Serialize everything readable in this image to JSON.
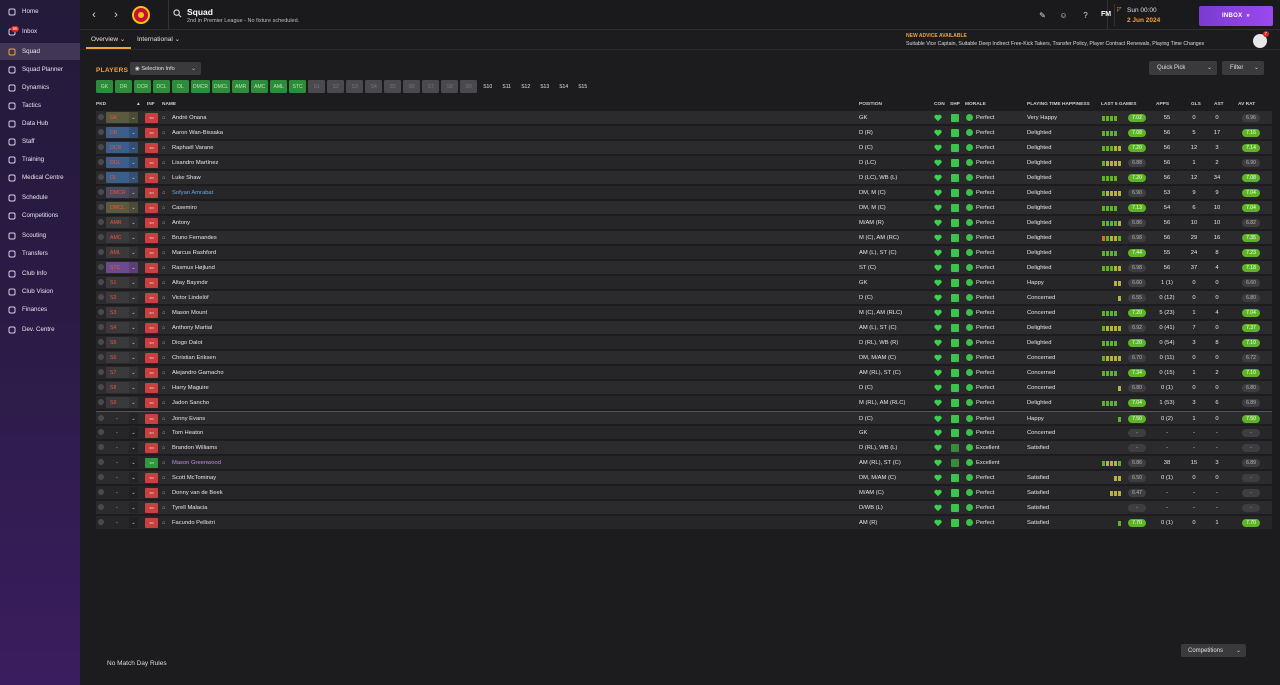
{
  "sidebar": {
    "items": [
      {
        "label": "Home",
        "icon": "home-icon"
      },
      {
        "label": "Inbox",
        "icon": "inbox-icon",
        "badge": "86"
      },
      {
        "label": "Squad",
        "icon": "squad-icon",
        "active": true
      },
      {
        "label": "Squad Planner",
        "icon": "planner-icon"
      },
      {
        "label": "Dynamics",
        "icon": "dynamics-icon"
      },
      {
        "label": "Tactics",
        "icon": "tactics-icon"
      },
      {
        "label": "Data Hub",
        "icon": "data-hub-icon"
      },
      {
        "label": "Staff",
        "icon": "staff-icon"
      },
      {
        "label": "Training",
        "icon": "training-icon"
      },
      {
        "label": "Medical Centre",
        "icon": "medical-icon"
      },
      {
        "label": "Schedule",
        "icon": "schedule-icon"
      },
      {
        "label": "Competitions",
        "icon": "trophy-icon"
      },
      {
        "label": "Scouting",
        "icon": "scouting-icon"
      },
      {
        "label": "Transfers",
        "icon": "transfers-icon"
      },
      {
        "label": "Club Info",
        "icon": "club-info-icon"
      },
      {
        "label": "Club Vision",
        "icon": "club-vision-icon"
      },
      {
        "label": "Finances",
        "icon": "finances-icon"
      },
      {
        "label": "Dev. Centre",
        "icon": "dev-centre-icon"
      }
    ]
  },
  "header": {
    "title": "Squad",
    "subtitle": "2nd in Premier League - No fixture scheduled.",
    "fm_logo": "FM",
    "date_day": "Sun 00:00",
    "date_full": "2 Jun 2024",
    "inbox_label": "INBOX",
    "inbox_arrows": "»"
  },
  "subheader": {
    "tabs": [
      "Overview",
      "International"
    ],
    "advice_title": "NEW ADVICE AVAILABLE",
    "advice_text": "Suitable Vice Captain, Suitable Deep Indirect Free-Kick Takers, Transfer Policy, Player Contract Renewals, Playing Time Changes",
    "notification_count": "7"
  },
  "toolbar": {
    "players_label": "PLAYERS",
    "selection_info": "Selection Info",
    "quick_pick": "Quick Pick",
    "filter": "Filter"
  },
  "position_buttons": [
    {
      "label": "GK",
      "style": "green"
    },
    {
      "label": "DR",
      "style": "green"
    },
    {
      "label": "DCR",
      "style": "green"
    },
    {
      "label": "DCL",
      "style": "green"
    },
    {
      "label": "DL",
      "style": "green"
    },
    {
      "label": "DMCR",
      "style": "green"
    },
    {
      "label": "DMCL",
      "style": "green"
    },
    {
      "label": "AMR",
      "style": "green"
    },
    {
      "label": "AMC",
      "style": "green"
    },
    {
      "label": "AML",
      "style": "green"
    },
    {
      "label": "STC",
      "style": "green"
    },
    {
      "label": "S1",
      "style": "grey"
    },
    {
      "label": "S2",
      "style": "grey"
    },
    {
      "label": "S3",
      "style": "grey"
    },
    {
      "label": "S4",
      "style": "grey"
    },
    {
      "label": "S5",
      "style": "grey"
    },
    {
      "label": "S6",
      "style": "grey"
    },
    {
      "label": "S7",
      "style": "grey"
    },
    {
      "label": "S8",
      "style": "grey"
    },
    {
      "label": "S9",
      "style": "grey"
    },
    {
      "label": "S10",
      "style": "plain"
    },
    {
      "label": "S11",
      "style": "plain"
    },
    {
      "label": "S12",
      "style": "plain"
    },
    {
      "label": "S13",
      "style": "plain"
    },
    {
      "label": "S14",
      "style": "plain"
    },
    {
      "label": "S15",
      "style": "plain"
    }
  ],
  "table": {
    "headers": {
      "pkd": "PKD",
      "inf": "INF",
      "name": "NAME",
      "position": "POSITION",
      "con": "CON",
      "shp": "SHP",
      "morale": "MORALE",
      "pth": "PLAYING TIME HAPPINESS",
      "last5": "LAST 5 GAMES",
      "apps": "APPS",
      "gls": "GLS",
      "ast": "AST",
      "avrat": "AV RAT"
    },
    "rows": [
      {
        "sel": "GK",
        "selc": "#5a5a40",
        "name": "André Onana",
        "pos": "GK",
        "morale": "Perfect",
        "pth": "Very Happy",
        "form": "ggggn",
        "r5": "7.02",
        "apps": "55",
        "gls": "0",
        "ast": "0",
        "avr": "6.96",
        "avrg": false
      },
      {
        "sel": "DR",
        "selc": "#3b5f8a",
        "name": "Aaron Wan-Bissaka",
        "pos": "D (R)",
        "morale": "Perfect",
        "pth": "Delighted",
        "form": "ggggn",
        "r5": "7.08",
        "apps": "56",
        "gls": "5",
        "ast": "17",
        "avr": "7.16",
        "avrg": true
      },
      {
        "sel": "DCR",
        "selc": "#3b5f8a",
        "name": "Raphaël Varane",
        "pos": "D (C)",
        "morale": "Perfect",
        "pth": "Delighted",
        "form": "gggoo",
        "r5": "7.20",
        "apps": "56",
        "gls": "12",
        "ast": "3",
        "avr": "7.14",
        "avrg": true
      },
      {
        "sel": "DCL",
        "selc": "#3b5f8a",
        "name": "Lisandro Martínez",
        "pos": "D (LC)",
        "morale": "Perfect",
        "pth": "Delighted",
        "form": "goooo",
        "r5": "6.88",
        "apps": "56",
        "gls": "1",
        "ast": "2",
        "avr": "6.90",
        "avrg": false
      },
      {
        "sel": "DL",
        "selc": "#3b5f8a",
        "name": "Luke Shaw",
        "pos": "D (LC), WB (L)",
        "morale": "Perfect",
        "pth": "Delighted",
        "form": "ggggn",
        "r5": "7.20",
        "apps": "56",
        "gls": "12",
        "ast": "34",
        "avr": "7.08",
        "avrg": true
      },
      {
        "sel": "DMCR",
        "selc": "#4a4a5e",
        "name": "Sofyan Amrabat",
        "pos": "DM, M (C)",
        "morale": "Perfect",
        "pth": "Delighted",
        "form": "goooo",
        "r5": "6.90",
        "apps": "53",
        "gls": "9",
        "ast": "9",
        "avr": "7.04",
        "avrg": true,
        "blue": true
      },
      {
        "sel": "DMCL",
        "selc": "#5a5a40",
        "name": "Casemiro",
        "pos": "DM, M (C)",
        "morale": "Perfect",
        "pth": "Delighted",
        "form": "ggggn",
        "r5": "7.13",
        "apps": "54",
        "gls": "6",
        "ast": "10",
        "avr": "7.04",
        "avrg": true
      },
      {
        "sel": "AMR",
        "selc": "#3a3a3d",
        "name": "Antony",
        "pos": "M/AM (R)",
        "morale": "Perfect",
        "pth": "Delighted",
        "form": "ggggo",
        "r5": "6.86",
        "apps": "56",
        "gls": "10",
        "ast": "10",
        "avr": "6.82",
        "avrg": false
      },
      {
        "sel": "AMC",
        "selc": "#3a3a3d",
        "name": "Bruno Fernandes",
        "pos": "M (C), AM (RC)",
        "morale": "Perfect",
        "pth": "Delighted",
        "form": "rgoog",
        "r5": "6.98",
        "apps": "56",
        "gls": "29",
        "ast": "16",
        "avr": "7.35",
        "avrg": true
      },
      {
        "sel": "AML",
        "selc": "#3a3a3d",
        "name": "Marcus Rashford",
        "pos": "AM (L), ST (C)",
        "morale": "Perfect",
        "pth": "Delighted",
        "form": "ggggn",
        "r5": "7.44",
        "apps": "55",
        "gls": "24",
        "ast": "8",
        "avr": "7.23",
        "avrg": true
      },
      {
        "sel": "STC",
        "selc": "#6b4a8e",
        "name": "Rasmus Højlund",
        "pos": "ST (C)",
        "morale": "Perfect",
        "pth": "Delighted",
        "form": "gggoo",
        "r5": "6.98",
        "apps": "56",
        "gls": "37",
        "ast": "4",
        "avr": "7.18",
        "avrg": true
      },
      {
        "sel": "S1",
        "selc": "#3a3a3d",
        "name": "Altay Bayındır",
        "pos": "GK",
        "morale": "Perfect",
        "pth": "Happy",
        "form": "xxxoo",
        "r5": "6.60",
        "apps": "1 (1)",
        "gls": "0",
        "ast": "0",
        "avr": "6.60",
        "avrg": false
      },
      {
        "sel": "S2",
        "selc": "#3a3a3d",
        "name": "Victor Lindelöf",
        "pos": "D (C)",
        "morale": "Perfect",
        "pth": "Concerned",
        "form": "xxxxo",
        "r5": "6.55",
        "apps": "0 (12)",
        "gls": "0",
        "ast": "0",
        "avr": "6.80",
        "avrg": false
      },
      {
        "sel": "S3",
        "selc": "#3a3a3d",
        "name": "Mason Mount",
        "pos": "M (C), AM (RLC)",
        "morale": "Perfect",
        "pth": "Concerned",
        "form": "ggggn",
        "r5": "7.20",
        "apps": "5 (23)",
        "gls": "1",
        "ast": "4",
        "avr": "7.04",
        "avrg": true
      },
      {
        "sel": "S4",
        "selc": "#3a3a3d",
        "name": "Anthony Martial",
        "pos": "AM (L), ST (C)",
        "morale": "Perfect",
        "pth": "Delighted",
        "form": "goooo",
        "r5": "6.92",
        "apps": "0 (41)",
        "gls": "7",
        "ast": "0",
        "avr": "7.37",
        "avrg": true
      },
      {
        "sel": "S5",
        "selc": "#3a3a3d",
        "name": "Diogo Dalot",
        "pos": "D (RL), WB (R)",
        "morale": "Perfect",
        "pth": "Delighted",
        "form": "ggggn",
        "r5": "7.20",
        "apps": "0 (54)",
        "gls": "3",
        "ast": "8",
        "avr": "7.10",
        "avrg": true
      },
      {
        "sel": "S6",
        "selc": "#3a3a3d",
        "name": "Christian Eriksen",
        "pos": "DM, M/AM (C)",
        "morale": "Perfect",
        "pth": "Concerned",
        "form": "goooo",
        "r5": "6.70",
        "apps": "0 (11)",
        "gls": "0",
        "ast": "0",
        "avr": "6.72",
        "avrg": false
      },
      {
        "sel": "S7",
        "selc": "#3a3a3d",
        "name": "Alejandro Garnacho",
        "pos": "AM (RL), ST (C)",
        "morale": "Perfect",
        "pth": "Concerned",
        "form": "ggggn",
        "r5": "7.34",
        "apps": "0 (15)",
        "gls": "1",
        "ast": "2",
        "avr": "7.10",
        "avrg": true
      },
      {
        "sel": "S8",
        "selc": "#3a3a3d",
        "name": "Harry Maguire",
        "pos": "D (C)",
        "morale": "Perfect",
        "pth": "Concerned",
        "form": "xxxxo",
        "r5": "6.80",
        "apps": "0 (1)",
        "gls": "0",
        "ast": "0",
        "avr": "6.80",
        "avrg": false
      },
      {
        "sel": "S9",
        "selc": "#3a3a3d",
        "name": "Jadon Sancho",
        "pos": "M (RL), AM (RLC)",
        "morale": "Perfect",
        "pth": "Delighted",
        "form": "ggggn",
        "r5": "7.04",
        "apps": "1 (53)",
        "gls": "3",
        "ast": "6",
        "avr": "6.89",
        "avrg": false
      },
      {
        "sel": "-",
        "selc": "",
        "name": "Jonny Evans",
        "pos": "D (C)",
        "morale": "Perfect",
        "pth": "Happy",
        "form": "xxxxg",
        "r5": "7.50",
        "apps": "0 (2)",
        "gls": "1",
        "ast": "0",
        "avr": "7.50",
        "avrg": true,
        "sep": true
      },
      {
        "sel": "-",
        "selc": "",
        "name": "Tom Heaton",
        "pos": "GK",
        "morale": "Perfect",
        "pth": "Concerned",
        "form": "",
        "r5": "-",
        "apps": "-",
        "gls": "-",
        "ast": "-",
        "avr": "-",
        "avrg": false
      },
      {
        "sel": "-",
        "selc": "",
        "name": "Brandon Williams",
        "pos": "D (RL), WB (L)",
        "morale": "Excellent",
        "pth": "Satisfied",
        "form": "",
        "r5": "-",
        "apps": "-",
        "gls": "-",
        "ast": "-",
        "avr": "-",
        "avrg": false
      },
      {
        "sel": "-",
        "selc": "",
        "name": "Mason Greenwood",
        "pos": "AM (RL), ST (C)",
        "morale": "Excellent",
        "pth": "",
        "form": "gooog",
        "r5": "6.86",
        "apps": "38",
        "gls": "15",
        "ast": "3",
        "avr": "6.89",
        "avrg": false,
        "purple": true,
        "infgreen": true
      },
      {
        "sel": "-",
        "selc": "",
        "name": "Scott McTominay",
        "pos": "DM, M/AM (C)",
        "morale": "Perfect",
        "pth": "Satisfied",
        "form": "xxxoo",
        "r5": "6.50",
        "apps": "0 (1)",
        "gls": "0",
        "ast": "0",
        "avr": "-",
        "avrg": false
      },
      {
        "sel": "-",
        "selc": "",
        "name": "Donny van de Beek",
        "pos": "M/AM (C)",
        "morale": "Perfect",
        "pth": "Satisfied",
        "form": "xxooo",
        "r5": "6.47",
        "apps": "-",
        "gls": "-",
        "ast": "-",
        "avr": "-",
        "avrg": false
      },
      {
        "sel": "-",
        "selc": "",
        "name": "Tyrell Malacia",
        "pos": "D/WB (L)",
        "morale": "Perfect",
        "pth": "Satisfied",
        "form": "",
        "r5": "-",
        "apps": "-",
        "gls": "-",
        "ast": "-",
        "avr": "-",
        "avrg": false
      },
      {
        "sel": "-",
        "selc": "",
        "name": "Facundo Pellistri",
        "pos": "AM (R)",
        "morale": "Perfect",
        "pth": "Satisfied",
        "form": "xxxxg",
        "r5": "7.70",
        "apps": "0 (1)",
        "gls": "0",
        "ast": "1",
        "avr": "7.70",
        "avrg": true
      }
    ]
  },
  "footer": {
    "no_match": "No Match Day Rules",
    "competitions": "Competitions"
  },
  "colors": {
    "accent": "#f2a33a",
    "green": "#3cc34b",
    "rating": "#5db526",
    "inbox": "#9b49ee"
  }
}
